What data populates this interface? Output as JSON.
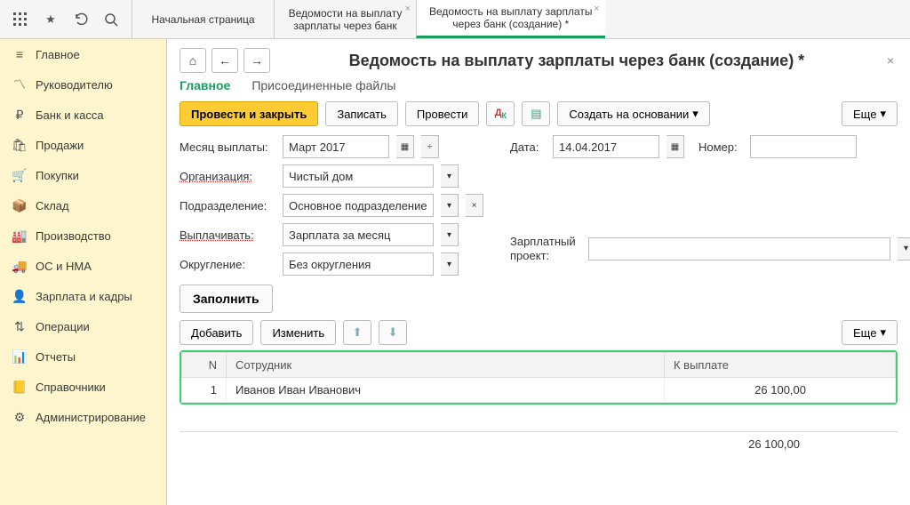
{
  "top_tabs": {
    "t0": "Начальная страница",
    "t1a": "Ведомости на выплату",
    "t1b": "зарплаты через банк",
    "t2a": "Ведомость на выплату зарплаты",
    "t2b": "через банк (создание) *"
  },
  "sidebar": {
    "items": [
      {
        "label": "Главное"
      },
      {
        "label": "Руководителю"
      },
      {
        "label": "Банк и касса"
      },
      {
        "label": "Продажи"
      },
      {
        "label": "Покупки"
      },
      {
        "label": "Склад"
      },
      {
        "label": "Производство"
      },
      {
        "label": "ОС и НМА"
      },
      {
        "label": "Зарплата и кадры"
      },
      {
        "label": "Операции"
      },
      {
        "label": "Отчеты"
      },
      {
        "label": "Справочники"
      },
      {
        "label": "Администрирование"
      }
    ]
  },
  "doc": {
    "title": "Ведомость на выплату зарплаты через банк (создание) *",
    "subtabs": {
      "main": "Главное",
      "files": "Присоединенные файлы"
    },
    "toolbar": {
      "post_close": "Провести и закрыть",
      "save": "Записать",
      "post": "Провести",
      "create_based": "Создать на основании",
      "more": "Еще"
    },
    "fields": {
      "month_label": "Месяц выплаты:",
      "month_value": "Март 2017",
      "date_label": "Дата:",
      "date_value": "14.04.2017",
      "number_label": "Номер:",
      "number_value": "",
      "org_label": "Организация:",
      "org_value": "Чистый дом",
      "dept_label": "Подразделение:",
      "dept_value": "Основное подразделение",
      "pay_label": "Выплачивать:",
      "pay_value": "Зарплата за месяц",
      "round_label": "Округление:",
      "round_value": "Без округления",
      "proj_label": "Зарплатный проект:",
      "proj_value": ""
    },
    "fill_btn": "Заполнить",
    "table_toolbar": {
      "add": "Добавить",
      "edit": "Изменить",
      "more": "Еще"
    },
    "table": {
      "columns": {
        "n": "N",
        "emp": "Сотрудник",
        "amount": "К выплате"
      },
      "rows": [
        {
          "n": "1",
          "emp": "Иванов Иван Иванович",
          "amount": "26 100,00"
        }
      ],
      "total": "26 100,00"
    }
  }
}
